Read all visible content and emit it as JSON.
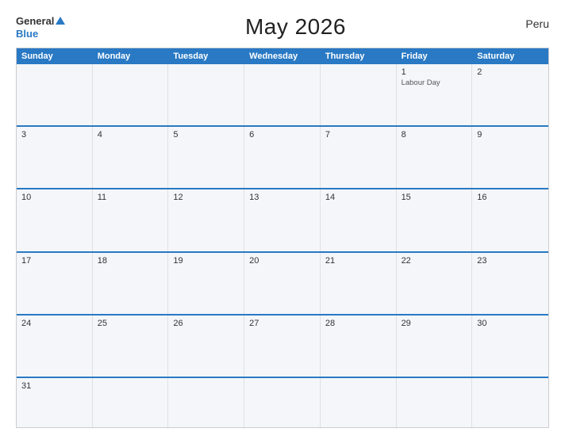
{
  "header": {
    "logo_general": "General",
    "logo_blue": "Blue",
    "title": "May 2026",
    "country": "Peru"
  },
  "days": {
    "headers": [
      "Sunday",
      "Monday",
      "Tuesday",
      "Wednesday",
      "Thursday",
      "Friday",
      "Saturday"
    ]
  },
  "weeks": [
    [
      {
        "num": "",
        "holiday": ""
      },
      {
        "num": "",
        "holiday": ""
      },
      {
        "num": "",
        "holiday": ""
      },
      {
        "num": "",
        "holiday": ""
      },
      {
        "num": "",
        "holiday": ""
      },
      {
        "num": "1",
        "holiday": "Labour Day"
      },
      {
        "num": "2",
        "holiday": ""
      }
    ],
    [
      {
        "num": "3",
        "holiday": ""
      },
      {
        "num": "4",
        "holiday": ""
      },
      {
        "num": "5",
        "holiday": ""
      },
      {
        "num": "6",
        "holiday": ""
      },
      {
        "num": "7",
        "holiday": ""
      },
      {
        "num": "8",
        "holiday": ""
      },
      {
        "num": "9",
        "holiday": ""
      }
    ],
    [
      {
        "num": "10",
        "holiday": ""
      },
      {
        "num": "11",
        "holiday": ""
      },
      {
        "num": "12",
        "holiday": ""
      },
      {
        "num": "13",
        "holiday": ""
      },
      {
        "num": "14",
        "holiday": ""
      },
      {
        "num": "15",
        "holiday": ""
      },
      {
        "num": "16",
        "holiday": ""
      }
    ],
    [
      {
        "num": "17",
        "holiday": ""
      },
      {
        "num": "18",
        "holiday": ""
      },
      {
        "num": "19",
        "holiday": ""
      },
      {
        "num": "20",
        "holiday": ""
      },
      {
        "num": "21",
        "holiday": ""
      },
      {
        "num": "22",
        "holiday": ""
      },
      {
        "num": "23",
        "holiday": ""
      }
    ],
    [
      {
        "num": "24",
        "holiday": ""
      },
      {
        "num": "25",
        "holiday": ""
      },
      {
        "num": "26",
        "holiday": ""
      },
      {
        "num": "27",
        "holiday": ""
      },
      {
        "num": "28",
        "holiday": ""
      },
      {
        "num": "29",
        "holiday": ""
      },
      {
        "num": "30",
        "holiday": ""
      }
    ],
    [
      {
        "num": "31",
        "holiday": ""
      },
      {
        "num": "",
        "holiday": ""
      },
      {
        "num": "",
        "holiday": ""
      },
      {
        "num": "",
        "holiday": ""
      },
      {
        "num": "",
        "holiday": ""
      },
      {
        "num": "",
        "holiday": ""
      },
      {
        "num": "",
        "holiday": ""
      }
    ]
  ]
}
